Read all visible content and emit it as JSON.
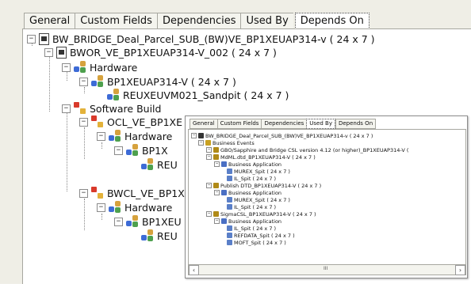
{
  "tabs": [
    "General",
    "Custom Fields",
    "Dependencies",
    "Used By",
    "Depends On"
  ],
  "active_tab": "Depends On",
  "tree": [
    {
      "label": "BW_BRIDGE_Deal_Parcel_SUB_(BW)VE_BP1XEUAP314-v ( 24 x 7 )",
      "icon": "document-icon"
    },
    {
      "label": "BWOR_VE_BP1XEUAP314-V_002 ( 24 x 7 )",
      "icon": "document-icon"
    },
    {
      "label": "Hardware",
      "icon": "network-icon"
    },
    {
      "label": "BP1XEUAP314-V ( 24 x 7 )",
      "icon": "network-icon"
    },
    {
      "label": "REUXEUVM021_Sandpit ( 24 x 7 )",
      "icon": "network-icon"
    },
    {
      "label": "Software Build",
      "icon": "software-icon"
    },
    {
      "label": "OCL_VE_BP1XE",
      "icon": "software-icon"
    },
    {
      "label": "Hardware",
      "icon": "network-icon"
    },
    {
      "label": "BP1X",
      "icon": "network-icon"
    },
    {
      "label": "REU",
      "icon": "network-icon"
    },
    {
      "label": "BWCL_VE_BP1X",
      "icon": "software-icon"
    },
    {
      "label": "Hardware",
      "icon": "network-icon"
    },
    {
      "label": "BP1XEU",
      "icon": "network-icon"
    },
    {
      "label": "REU",
      "icon": "network-icon"
    }
  ],
  "popup": {
    "tabs": [
      "General",
      "Custom Fields",
      "Dependencies",
      "Used By",
      "Depends On"
    ],
    "active_tab": "Used By",
    "rows": [
      "BW_BRIDGE_Deal_Parcel_SUB_(BW)VE_BP1XEUAP314-v ( 24 x 7 )",
      "Business Events",
      "GBO/Sapphire and Bridge CSL version 4.12 (or higher)_BP1XEUAP314-V (",
      "MdML.dtd_BP1XEUAP314-V ( 24 x 7 )",
      "Business Application",
      "MUREX_Spit ( 24 x 7 )",
      "IL_Spit ( 24 x 7 )",
      "Publish DTD_BP1XEUAP314-V ( 24 x 7 )",
      "Business Application",
      "MUREX_Spit ( 24 x 7 )",
      "IL_Spit ( 24 x 7 )",
      "SigmaCSL_BP1XEUAP314-V ( 24 x 7 )",
      "Business Application",
      "IL_Spit ( 24 x 7 )",
      "REFDATA_Spit ( 24 x 7 )",
      "MOFT_Spit ( 24 x 7 )"
    ],
    "scroll_grip": "III"
  }
}
